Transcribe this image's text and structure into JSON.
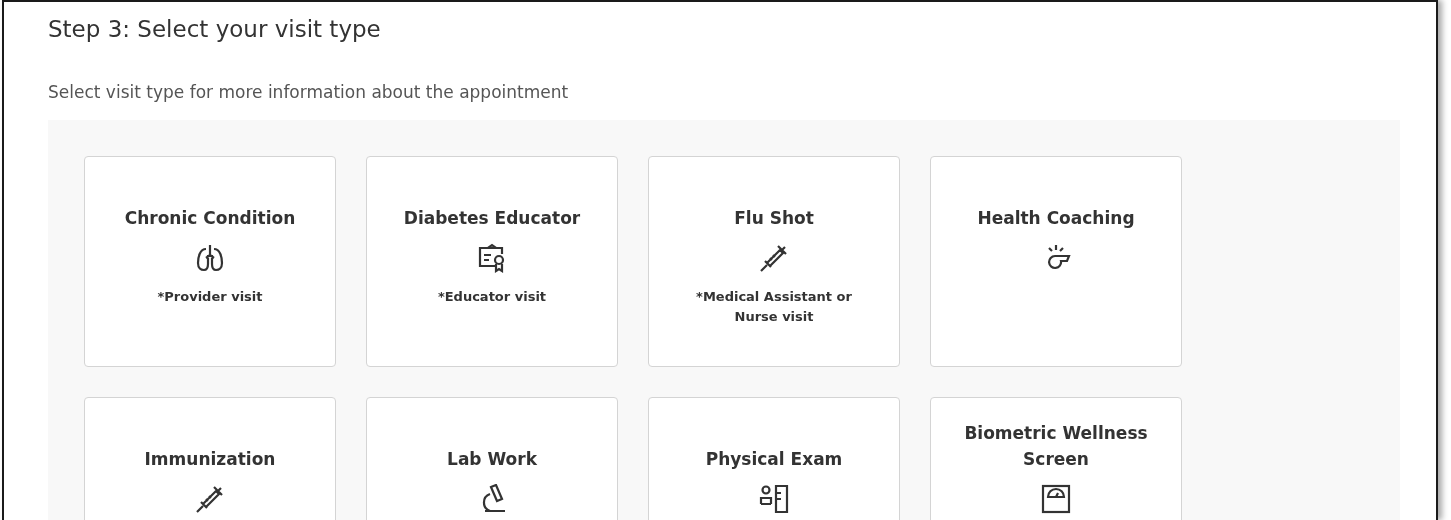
{
  "heading": "Step 3: Select your visit type",
  "subtitle": "Select visit type for more information about the appointment",
  "visit_types": [
    {
      "title": "Chronic Condition",
      "kind": "lungs",
      "note": "*Provider visit"
    },
    {
      "title": "Diabetes Educator",
      "kind": "certificate",
      "note": "*Educator visit"
    },
    {
      "title": "Flu Shot",
      "kind": "syringe",
      "note": "*Medical Assistant or Nurse visit"
    },
    {
      "title": "Health Coaching",
      "kind": "whistle"
    },
    {
      "title": "Immunization",
      "kind": "syringe"
    },
    {
      "title": "Lab Work",
      "kind": "microscope"
    },
    {
      "title": "Physical Exam",
      "kind": "exam"
    },
    {
      "title": "Biometric Wellness Screen",
      "kind": "scale"
    }
  ]
}
